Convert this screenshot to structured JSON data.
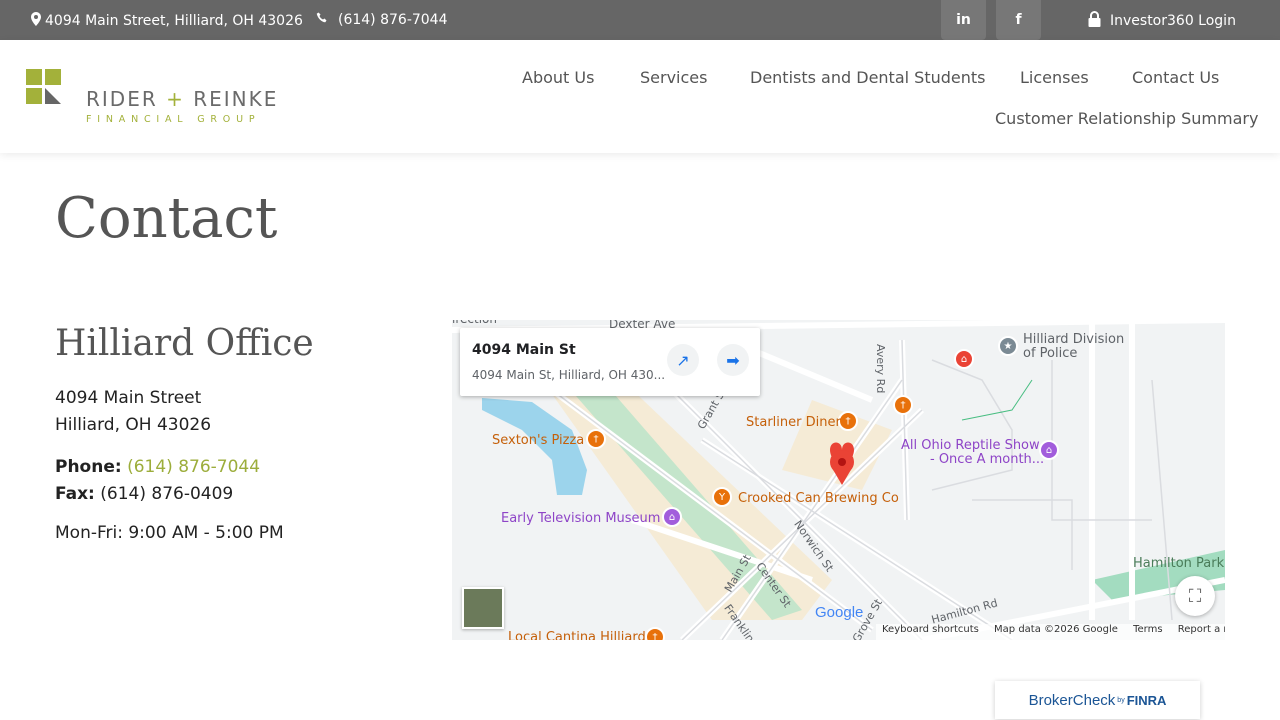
{
  "topbar": {
    "address": "4094 Main Street, Hilliard, OH 43026",
    "phone": "(614) 876-7044",
    "linkedin_label": "in",
    "facebook_label": "f",
    "login_label": "Investor360 Login"
  },
  "logo": {
    "main": [
      "RIDER",
      "+",
      "REINKE"
    ],
    "sub": "FINANCIAL GROUP"
  },
  "nav": {
    "items": [
      "About Us",
      "Services",
      "Dentists and Dental Students",
      "Licenses",
      "Contact Us",
      "Customer Relationship Summary"
    ]
  },
  "page": {
    "title": "Contact",
    "office_title": "Hilliard Office",
    "address_line1": "4094 Main Street",
    "address_line2": "Hilliard, OH 43026",
    "phone_label": "Phone:",
    "phone_value": "(614) 876-7044",
    "fax_label": "Fax:",
    "fax_value": "(614) 876-0409",
    "hours": "Mon-Fri: 9:00 AM - 5:00 PM"
  },
  "map": {
    "card_title": "4094 Main St",
    "card_subtitle": "4094 Main St, Hilliard, OH 430...",
    "labels": {
      "dexter": "Dexter Ave",
      "direction": "irection",
      "avery": "Avery Rd",
      "police1": "Hilliard Division",
      "police2": "of Police",
      "starliner": "Starliner Diner",
      "sextons": "Sexton's Pizza",
      "reptile1": "All Ohio Reptile Show",
      "reptile2": "- Once A month...",
      "grant": "Grant St",
      "crooked": "Crooked Can Brewing Co",
      "tv_museum": "Early Television Museum",
      "norwich": "Norwich St",
      "main": "Main St",
      "center": "Center St",
      "franklin": "Franklin St",
      "grove": "Grove St",
      "hamilton_rd": "Hamilton Rd",
      "hamilton_park": "Hamilton Park",
      "cantina": "Local Cantina Hilliard"
    },
    "google": "Google",
    "footer": [
      "Keyboard shortcuts",
      "Map data ©2026 Google",
      "Terms",
      "Report a map error"
    ]
  },
  "brokercheck": {
    "broker": "Broker",
    "check": "Check",
    "by": "by",
    "finra": "FINRA"
  },
  "colors": {
    "topbar": "#666666",
    "accent_green": "#a3b13a",
    "link_green": "#9cad3b",
    "poi_orange": "#e8710a",
    "poi_purple": "#a25ddc",
    "marker_red": "#ea4335"
  }
}
